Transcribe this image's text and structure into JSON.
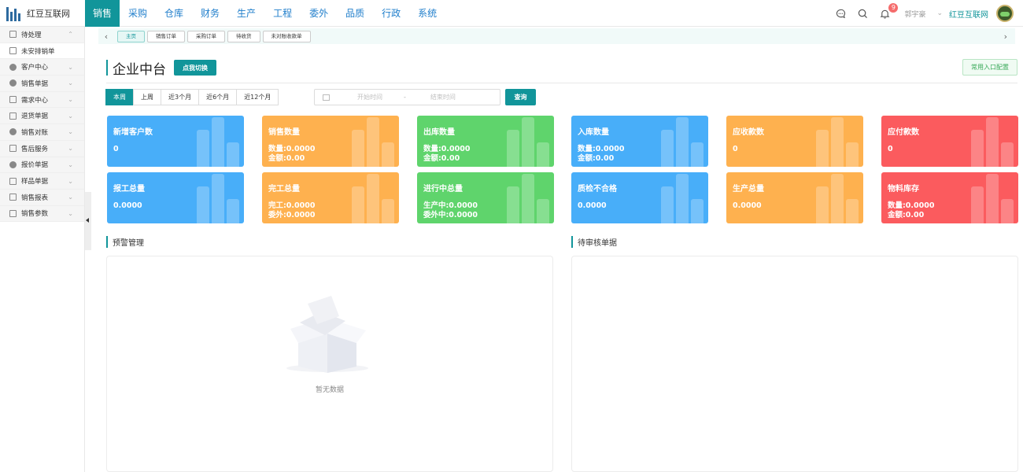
{
  "brand": {
    "name": "红豆互联网"
  },
  "nav": {
    "items": [
      "销售",
      "采购",
      "仓库",
      "财务",
      "生产",
      "工程",
      "委外",
      "品质",
      "行政",
      "系统"
    ]
  },
  "header": {
    "notification_count": "9",
    "user": "郭宇豪",
    "company": "红豆互联网"
  },
  "sidebar": {
    "items": [
      "待处理",
      "未安排销单",
      "客户中心",
      "销售单据",
      "需求中心",
      "退货单据",
      "销售对账",
      "售后服务",
      "报价单据",
      "样品单据",
      "销售报表",
      "销售参数"
    ]
  },
  "tabs": {
    "items": [
      "主页",
      "销售订单",
      "采购订单",
      "待收货",
      "未对账收款单"
    ]
  },
  "page": {
    "title": "企业中台",
    "switch_label": "点我切换",
    "config_label": "常用入口配置"
  },
  "filters": {
    "periods": [
      "本周",
      "上周",
      "近3个月",
      "近6个月",
      "近12个月"
    ],
    "start_placeholder": "开始时间",
    "range_sep": "-",
    "end_placeholder": "结束时间",
    "query_label": "查询"
  },
  "cards": [
    {
      "title": "新增客户数",
      "lines": [
        "0"
      ],
      "color": "#48aef9"
    },
    {
      "title": "销售数量",
      "lines": [
        "数量:0.0000",
        "金额:0.00"
      ],
      "color": "#feb14f"
    },
    {
      "title": "出库数量",
      "lines": [
        "数量:0.0000",
        "金额:0.00"
      ],
      "color": "#5fd46c"
    },
    {
      "title": "入库数量",
      "lines": [
        "数量:0.0000",
        "金额:0.00"
      ],
      "color": "#48aef9"
    },
    {
      "title": "应收款数",
      "lines": [
        "0"
      ],
      "color": "#feb14f"
    },
    {
      "title": "应付款数",
      "lines": [
        "0"
      ],
      "color": "#fb5b5e"
    },
    {
      "title": "报工总量",
      "lines": [
        "0.0000"
      ],
      "color": "#48aef9"
    },
    {
      "title": "完工总量",
      "lines": [
        "完工:0.0000",
        "委外:0.0000"
      ],
      "color": "#feb14f"
    },
    {
      "title": "进行中总量",
      "lines": [
        "生产中:0.0000",
        "委外中:0.0000"
      ],
      "color": "#5fd46c"
    },
    {
      "title": "质检不合格",
      "lines": [
        "0.0000"
      ],
      "color": "#48aef9"
    },
    {
      "title": "生产总量",
      "lines": [
        "0.0000"
      ],
      "color": "#feb14f"
    },
    {
      "title": "物料库存",
      "lines": [
        "数量:0.0000",
        "金额:0.00"
      ],
      "color": "#fb5b5e"
    }
  ],
  "panels": {
    "warning": {
      "title": "预警管理",
      "empty_text": "暂无数据"
    },
    "pending": {
      "title": "待审核单据"
    }
  }
}
